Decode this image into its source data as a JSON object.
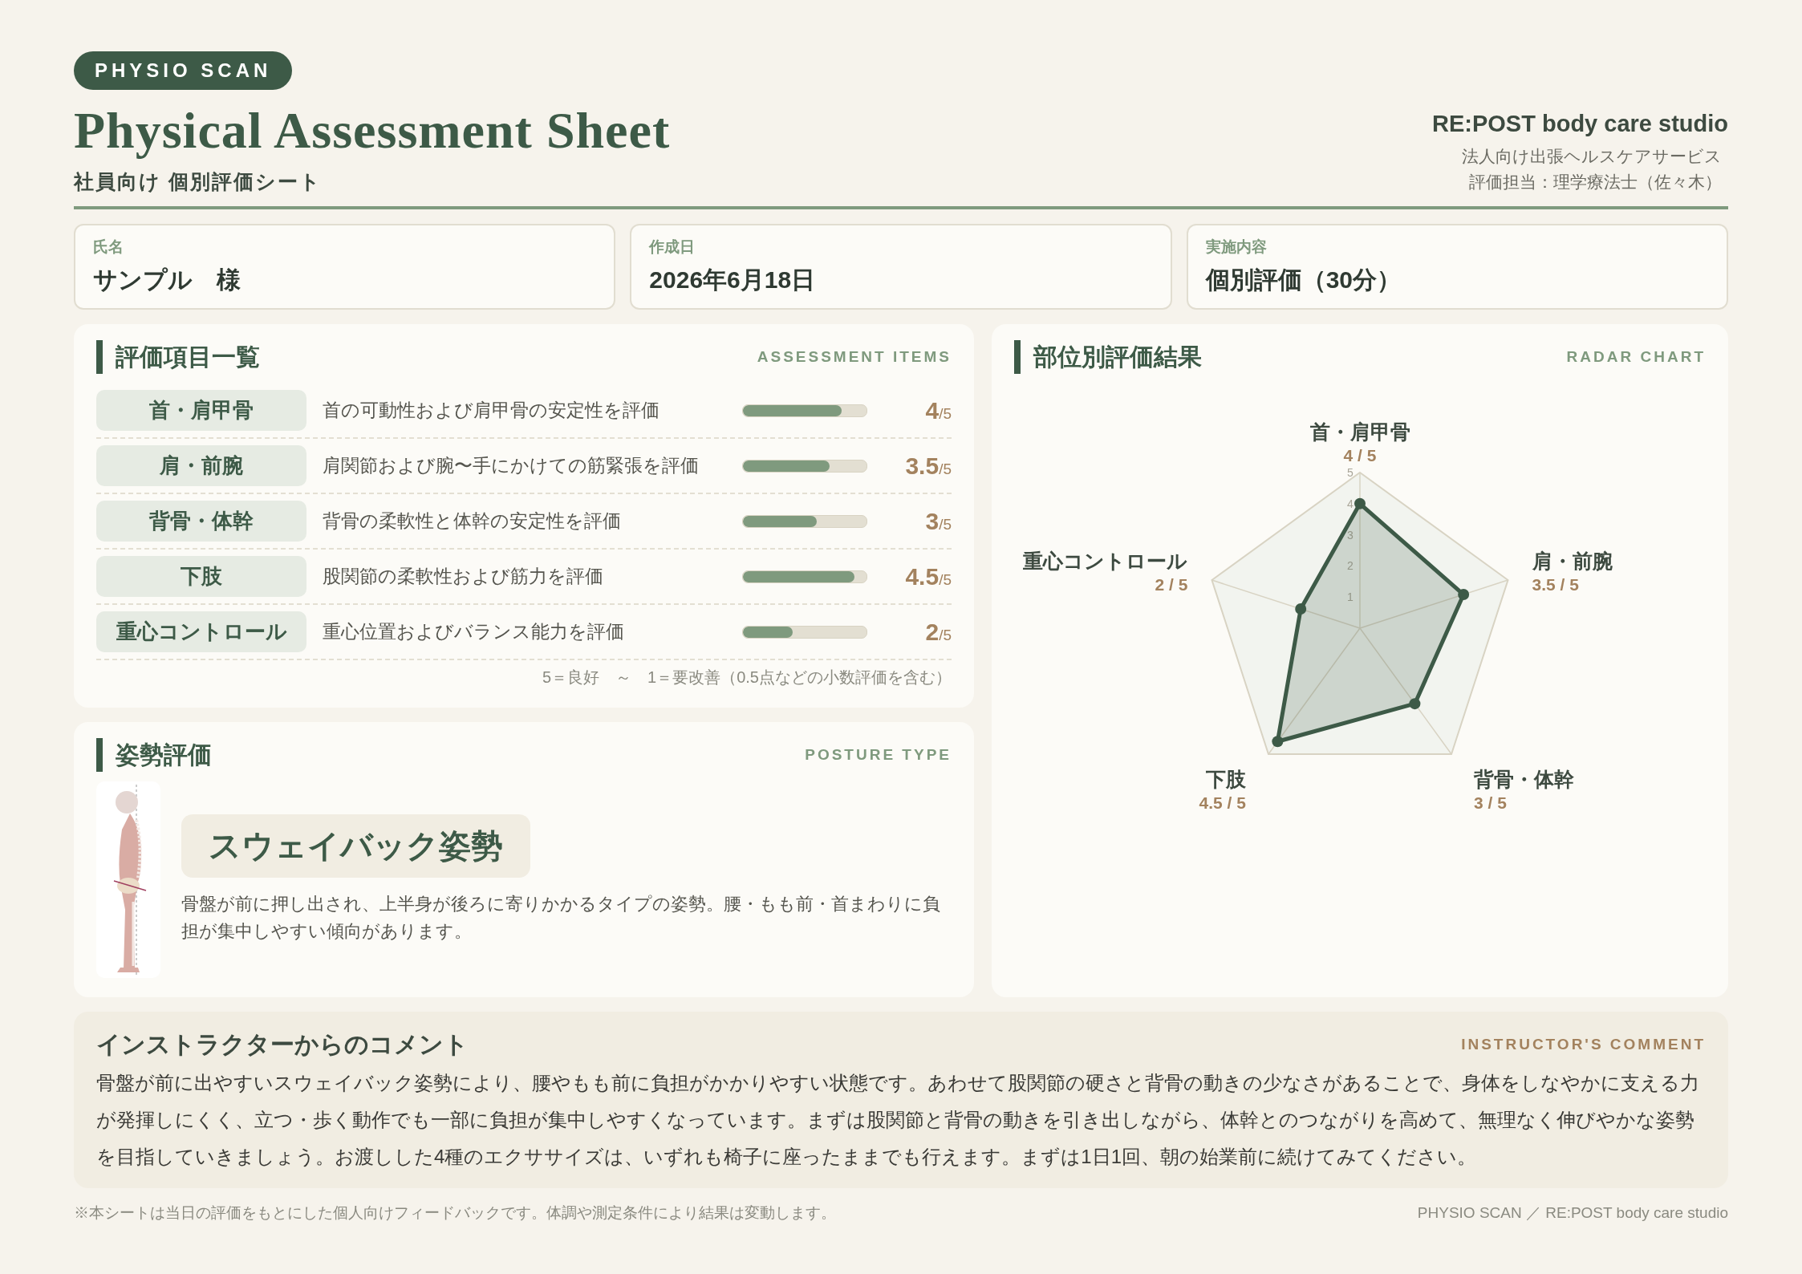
{
  "badge": "PHYSIO SCAN",
  "title": "Physical Assessment Sheet",
  "subtitle": "社員向け 個別評価シート",
  "studio": {
    "name": "RE:POST body care studio",
    "lines": [
      "法人向け出張ヘルスケアサービス",
      "評価担当：理学療法士（佐々木）"
    ]
  },
  "info": [
    {
      "label": "氏名",
      "value": "サンプル　様"
    },
    {
      "label": "作成日",
      "value": "2026年6月18日"
    },
    {
      "label": "実施内容",
      "value": "個別評価（30分）"
    }
  ],
  "assessment": {
    "title": "評価項目一覧",
    "tag": "ASSESSMENT ITEMS",
    "items": [
      {
        "name": "首・肩甲骨",
        "desc": "首の可動性および肩甲骨の安定性を評価",
        "level": 0.8,
        "score": "4",
        "max": "/5"
      },
      {
        "name": "肩・前腕",
        "desc": "肩関節および腕〜手にかけての筋緊張を評価",
        "level": 0.7,
        "score": "3.5",
        "max": "/5"
      },
      {
        "name": "背骨・体幹",
        "desc": "背骨の柔軟性と体幹の安定性を評価",
        "level": 0.6,
        "score": "3",
        "max": "/5"
      },
      {
        "name": "下肢",
        "desc": "股関節の柔軟性および筋力を評価",
        "level": 0.9,
        "score": "4.5",
        "max": "/5"
      },
      {
        "name": "重心コントロール",
        "desc": "重心位置およびバランス能力を評価",
        "level": 0.4,
        "score": "2",
        "max": "/5"
      }
    ],
    "legend": "5＝良好　～　1＝要改善（0.5点などの小数評価を含む）"
  },
  "posture": {
    "title": "姿勢評価",
    "tag": "POSTURE TYPE",
    "type": "スウェイバック姿勢",
    "desc": "骨盤が前に押し出され、上半身が後ろに寄りかかるタイプの姿勢。腰・もも前・首まわりに負担が集中しやすい傾向があります。"
  },
  "radar": {
    "title": "部位別評価結果",
    "tag": "RADAR CHART",
    "chart_data": {
      "type": "radar",
      "categories": [
        "首・肩甲骨",
        "肩・前腕",
        "背骨・体幹",
        "下肢",
        "重心コントロール"
      ],
      "values": [
        4,
        3.5,
        3,
        4.5,
        2
      ],
      "ylim": [
        0,
        5
      ],
      "yticks": [
        1,
        2,
        3,
        4,
        5
      ]
    },
    "score_labels": [
      "4 / 5",
      "3.5 / 5",
      "3 / 5",
      "4.5 / 5",
      "2 / 5"
    ]
  },
  "comment": {
    "title": "インストラクターからのコメント",
    "tag": "INSTRUCTOR'S COMMENT",
    "text": "骨盤が前に出やすいスウェイバック姿勢により、腰やもも前に負担がかかりやすい状態です。あわせて股関節の硬さと背骨の動きの少なさがあることで、身体をしなやかに支える力が発揮しにくく、立つ・歩く動作でも一部に負担が集中しやすくなっています。まずは股関節と背骨の動きを引き出しながら、体幹とのつながりを高めて、無理なく伸びやかな姿勢を目指していきましょう。お渡しした4種のエクササイズは、いずれも椅子に座ったままでも行えます。まずは1日1回、朝の始業前に続けてみてください。"
  },
  "footer": {
    "note": "※本シートは当日の評価をもとにした個人向けフィードバックです。体調や測定条件により結果は変動します。",
    "credit": "PHYSIO SCAN ／ RE:POST body care studio"
  }
}
